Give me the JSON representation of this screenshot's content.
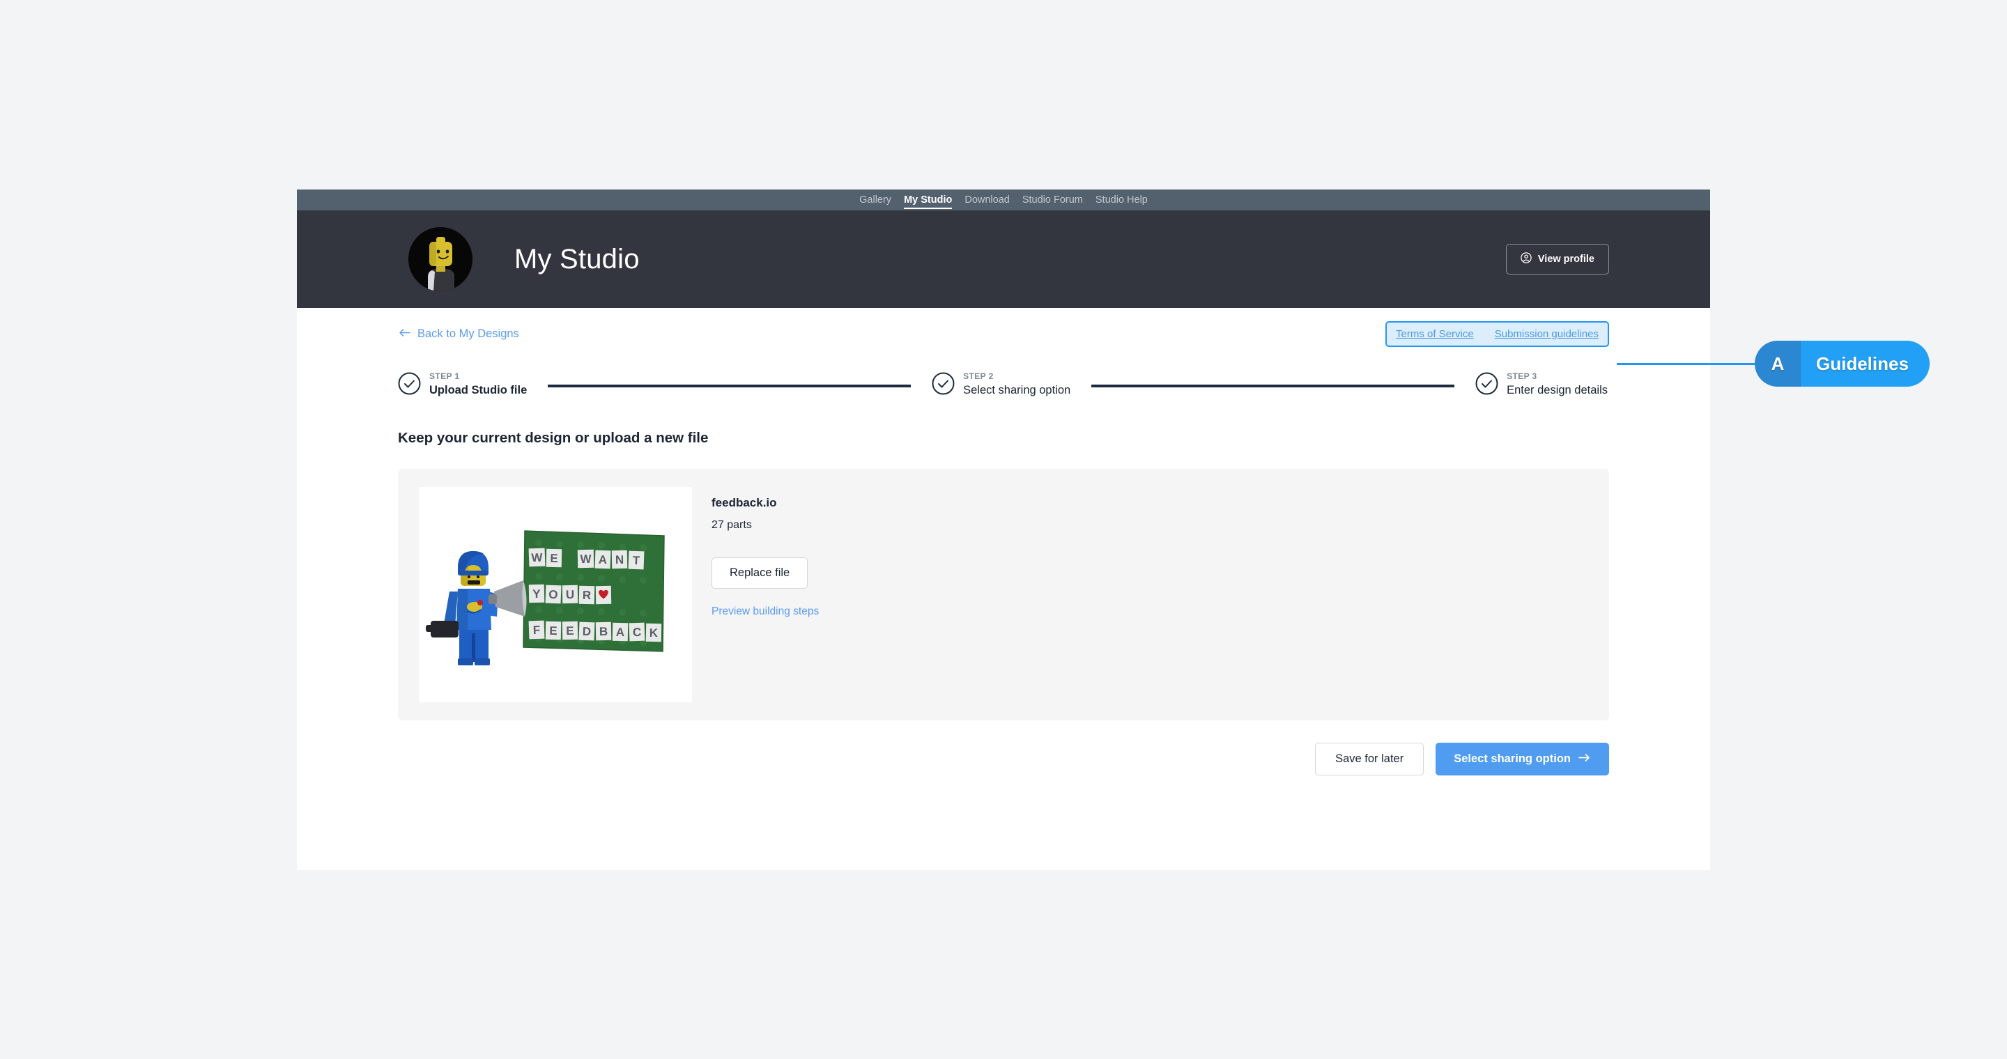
{
  "nav": {
    "items": [
      {
        "label": "Gallery",
        "active": false
      },
      {
        "label": "My Studio",
        "active": true
      },
      {
        "label": "Download",
        "active": false
      },
      {
        "label": "Studio Forum",
        "active": false
      },
      {
        "label": "Studio Help",
        "active": false
      }
    ]
  },
  "header": {
    "title": "My Studio",
    "view_profile_label": "View profile",
    "view_profile_icon": "user-circle-icon",
    "avatar_icon": "lego-minifigure-avatar"
  },
  "breadcrumb": {
    "back_label": "Back to My Designs",
    "back_icon": "arrow-left-icon"
  },
  "guidelines": {
    "terms_label": "Terms of Service",
    "submission_label": "Submission guidelines"
  },
  "stepper": {
    "steps": [
      {
        "num": "STEP 1",
        "title": "Upload Studio file",
        "state": "current"
      },
      {
        "num": "STEP 2",
        "title": "Select sharing option",
        "state": "complete"
      },
      {
        "num": "STEP 3",
        "title": "Enter design details",
        "state": "complete"
      }
    ]
  },
  "main": {
    "section_heading": "Keep your current design or upload a new file",
    "file": {
      "name": "feedback.io",
      "parts": "27 parts",
      "replace_label": "Replace file",
      "preview_label": "Preview building steps",
      "thumbnail_text_lines": [
        "WE WANT",
        "YOUR ♥",
        "FEEDBACK"
      ],
      "thumbnail_icon": "lego-minifigure-megaphone-thumbnail"
    }
  },
  "footer": {
    "save_label": "Save for later",
    "next_label": "Select sharing option",
    "next_icon": "arrow-right-icon"
  },
  "annotation": {
    "key": "A",
    "label": "Guidelines"
  },
  "colors": {
    "nav_bar": "#53616e",
    "header_bg": "#33363f",
    "page_bg": "#f3f4f6",
    "card_bg": "#f5f5f6",
    "accent_blue": "#4f9cf0",
    "link_blue": "#5a9bf0",
    "annotation_blue": "#22a0f5",
    "annotation_key_blue": "#2b87d1",
    "step_dark": "#1d2b3e"
  }
}
